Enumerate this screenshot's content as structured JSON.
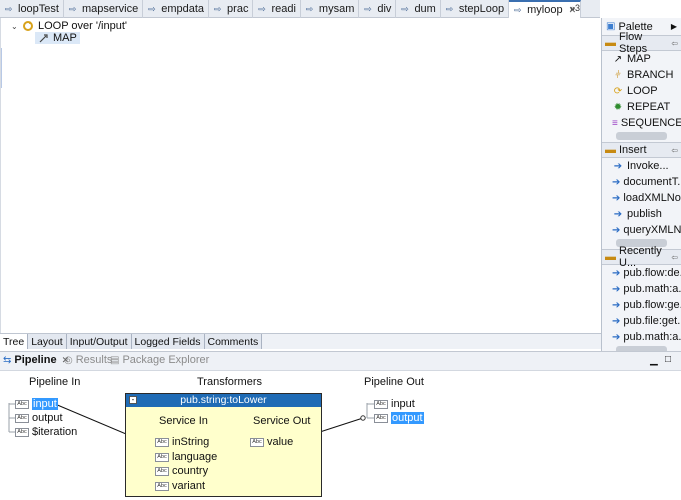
{
  "editor_tabs": [
    {
      "label": "loopTest",
      "active": false
    },
    {
      "label": "mapservice",
      "active": false
    },
    {
      "label": "empdata",
      "active": false
    },
    {
      "label": "prac",
      "active": false
    },
    {
      "label": "readi",
      "active": false
    },
    {
      "label": "mysam",
      "active": false
    },
    {
      "label": "div",
      "active": false
    },
    {
      "label": "dum",
      "active": false
    },
    {
      "label": "stepLoop",
      "active": false
    },
    {
      "label": "myloop",
      "active": true
    }
  ],
  "overflow_count": "»3",
  "tree": {
    "loop_label": "LOOP over '/input'",
    "map_label": "MAP"
  },
  "palette": {
    "title": "Palette",
    "drawers": [
      {
        "label": "Flow Steps",
        "items": [
          "MAP",
          "BRANCH",
          "LOOP",
          "REPEAT",
          "SEQUENCE"
        ]
      },
      {
        "label": "Insert",
        "items": [
          "Invoke...",
          "documentT...",
          "loadXMLNo...",
          "publish",
          "queryXMLN..."
        ]
      },
      {
        "label": "Recently U...",
        "items": [
          "pub.flow:de...",
          "pub.math:a...",
          "pub.flow:ge...",
          "pub.file:get...",
          "pub.math:a..."
        ]
      }
    ]
  },
  "view_tabs": [
    "Tree",
    "Layout",
    "Input/Output",
    "Logged Fields",
    "Comments"
  ],
  "bottom_panel": {
    "tabs": [
      "Pipeline",
      "Results",
      "Package Explorer"
    ],
    "pipeline_in_title": "Pipeline In",
    "transformers_title": "Transformers",
    "pipeline_out_title": "Pipeline Out",
    "pipeline_in": [
      "input",
      "output",
      "$iteration"
    ],
    "pipeline_out": [
      "input",
      "output"
    ],
    "transformer": {
      "name": "pub.string:toLower",
      "service_in_title": "Service In",
      "service_out_title": "Service Out",
      "service_in": [
        "inString",
        "language",
        "country",
        "variant"
      ],
      "service_out": [
        "value"
      ]
    }
  },
  "colors": {
    "transformer_header": "#1f6bb5",
    "transformer_body": "#ffffcc",
    "selection": "#3399ff"
  }
}
